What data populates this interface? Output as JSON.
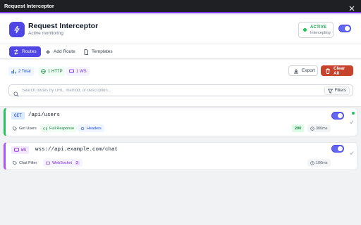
{
  "window": {
    "title": "Request Interceptor"
  },
  "app": {
    "title": "Request Interceptor",
    "subtitle": "Active monitoring",
    "status_label": "ACTIVE",
    "status_sub": "Intercepting",
    "enabled": true
  },
  "tabs": [
    {
      "label": "Routes",
      "icon": "routes-icon",
      "active": true
    },
    {
      "label": "Add Route",
      "icon": "plus-icon",
      "active": false
    },
    {
      "label": "Templates",
      "icon": "document-icon",
      "active": false
    }
  ],
  "stats": {
    "total": "2 Total",
    "http": "1 HTTP",
    "ws": "1 WS"
  },
  "actions": {
    "export_label": "Export",
    "clear_label": "Clear All"
  },
  "search": {
    "placeholder": "Search routes by URL, method, or description...",
    "value": "",
    "filters_label": "Filters"
  },
  "routes": [
    {
      "method": "GET",
      "path": "/api/users",
      "name": "Get Users",
      "response_type": "Full Response",
      "extra": "Headers",
      "status_code": "200",
      "delay": "300ms",
      "enabled": true
    },
    {
      "method": "WS",
      "path": "wss://api.example.com/chat",
      "name": "Chat Filter",
      "response_type": "WebSocket",
      "count": "2",
      "delay": "100ms",
      "enabled": true
    }
  ],
  "colors": {
    "accent": "#4f46e5",
    "success": "#22c55e",
    "danger": "#c8432d",
    "ws": "#a855f7",
    "titlebar": "#1f2023"
  }
}
